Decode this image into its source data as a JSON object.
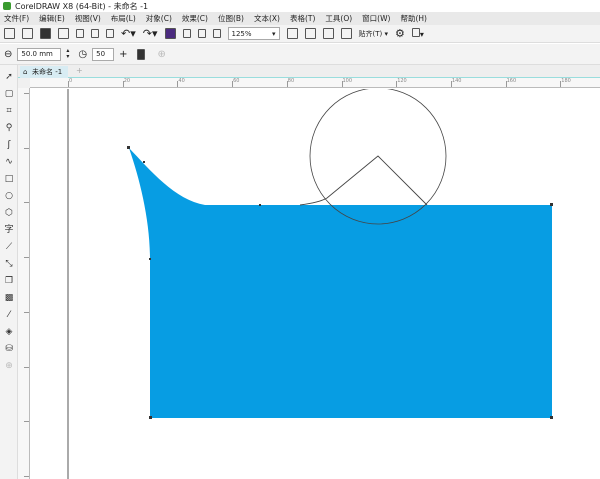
{
  "window": {
    "title": "CorelDRAW X8 (64-Bit) - 未命名 -1"
  },
  "menu": [
    "文件(F)",
    "编辑(E)",
    "视图(V)",
    "布局(L)",
    "对象(C)",
    "效果(C)",
    "位图(B)",
    "文本(X)",
    "表格(T)",
    "工具(O)",
    "窗口(W)",
    "帮助(H)"
  ],
  "toolbar": {
    "zoom": "125%",
    "snap": "贴齐(T)"
  },
  "propbar": {
    "size": "50.0 mm",
    "count": "50"
  },
  "tab": {
    "label": "未命名 -1"
  },
  "ruler": {
    "labels": [
      "0",
      "20",
      "40",
      "60",
      "80",
      "100",
      "120",
      "140",
      "160",
      "180"
    ]
  },
  "colors": {
    "fill": "#079de3",
    "outline": "#444444"
  },
  "tools": [
    "pick-icon",
    "shape-icon",
    "crop-icon",
    "zoom-icon",
    "freehand-icon",
    "artistic-media-icon",
    "rectangle-icon",
    "ellipse-icon",
    "polygon-icon",
    "text-icon",
    "dimension-icon",
    "connector-icon",
    "drop-shadow-icon",
    "transparency-icon",
    "eyedropper-icon",
    "interactive-fill-icon",
    "smart-fill-icon",
    "add-icon"
  ]
}
